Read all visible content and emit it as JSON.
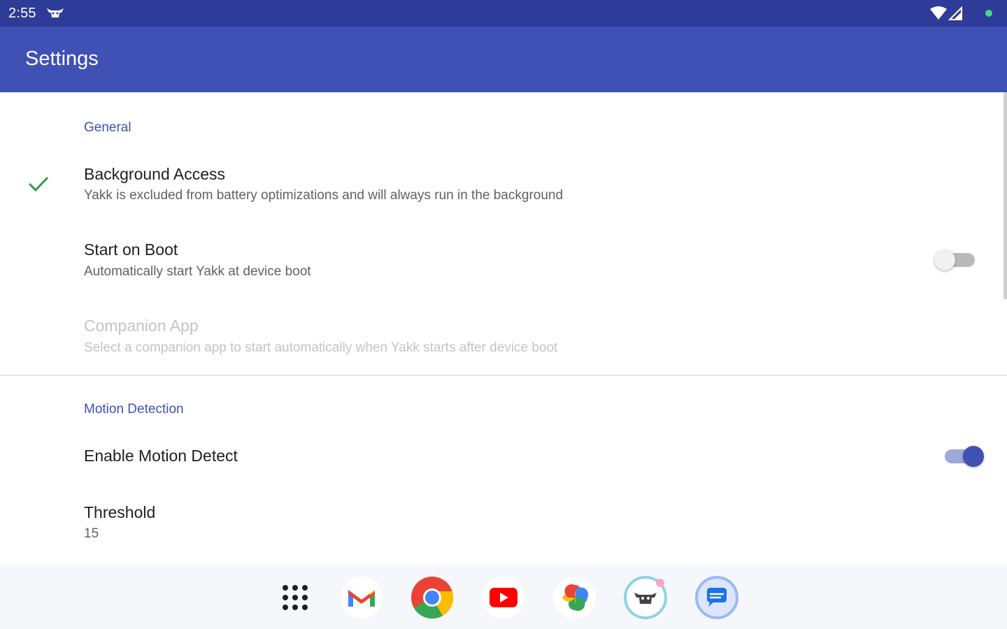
{
  "status_bar": {
    "time": "2:55"
  },
  "app_bar": {
    "title": "Settings"
  },
  "sections": {
    "general": {
      "header": "General",
      "background_access": {
        "title": "Background Access",
        "summary": "Yakk is excluded from battery optimizations and will always run in the background",
        "icon": "check-icon"
      },
      "start_on_boot": {
        "title": "Start on Boot",
        "summary": "Automatically start Yakk at device boot",
        "enabled": false
      },
      "companion_app": {
        "title": "Companion App",
        "summary": "Select a companion app to start automatically when Yakk starts after device boot",
        "disabled": true
      }
    },
    "motion_detection": {
      "header": "Motion Detection",
      "enable_motion_detect": {
        "title": "Enable Motion Detect",
        "enabled": true
      },
      "threshold": {
        "title": "Threshold",
        "value": "15"
      }
    }
  },
  "taskbar": {
    "apps": [
      "app-drawer-icon",
      "gmail-icon",
      "chrome-icon",
      "youtube-icon",
      "photos-icon",
      "yakk-icon",
      "messages-icon"
    ]
  },
  "colors": {
    "primary": "#3f51b5",
    "primary_dark": "#2e3b98",
    "check_green": "#2e9e3e"
  }
}
